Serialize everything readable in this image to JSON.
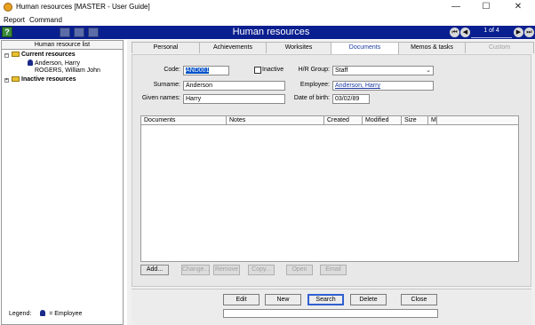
{
  "window": {
    "title": "Human resources [MASTER - User Guide]",
    "minimize": "—",
    "maximize": "☐",
    "close": "✕"
  },
  "menu": [
    "Report",
    "Command"
  ],
  "toolbar": {
    "help": "?",
    "module_title": "Human resources",
    "pager": "1 of 4"
  },
  "sidebar": {
    "header": "Human resource list",
    "current_group": "Current resources",
    "items": [
      "Anderson, Harry",
      "ROGERS, William John"
    ],
    "inactive_group": "Inactive resources",
    "legend_label": "Legend:",
    "legend_text": "= Employee"
  },
  "tabs": [
    {
      "label": "Personal",
      "state": "normal"
    },
    {
      "label": "Achievements",
      "state": "normal"
    },
    {
      "label": "Worksites",
      "state": "normal"
    },
    {
      "label": "Documents",
      "state": "active"
    },
    {
      "label": "Memos & tasks",
      "state": "normal"
    },
    {
      "label": "Custom",
      "state": "disabled"
    }
  ],
  "form": {
    "code_label": "Code:",
    "code_value": "AND001",
    "inactive_label": "Inactive",
    "hr_group_label": "H/R Group:",
    "hr_group_value": "Staff",
    "surname_label": "Surname:",
    "surname_value": "Anderson",
    "employee_label": "Employee:",
    "employee_value": "Anderson, Harry",
    "given_names_label": "Given names:",
    "given_names_value": "Harry",
    "dob_label": "Date of birth:",
    "dob_value": "03/02/89"
  },
  "documents_table": {
    "columns": [
      "Documents",
      "Notes",
      "Created",
      "Modified",
      "Size",
      "M"
    ],
    "rows": []
  },
  "doc_buttons": {
    "add": "Add...",
    "change": "Change...",
    "remove": "Remove",
    "copy": "Copy...",
    "open": "Open",
    "email": "Email"
  },
  "actions": {
    "edit": "Edit",
    "new": "New",
    "search": "Search",
    "delete": "Delete",
    "close": "Close"
  },
  "colors": {
    "toolbar_bg": "#0a1f8f",
    "active_tab_text": "#1a3aa0",
    "link": "#1a3aa0"
  },
  "icons": {
    "app": "app-icon",
    "folder": "folder-icon",
    "person": "person-icon",
    "first": "first-record-icon",
    "prev": "prev-record-icon",
    "next": "next-record-icon",
    "last": "last-record-icon"
  }
}
